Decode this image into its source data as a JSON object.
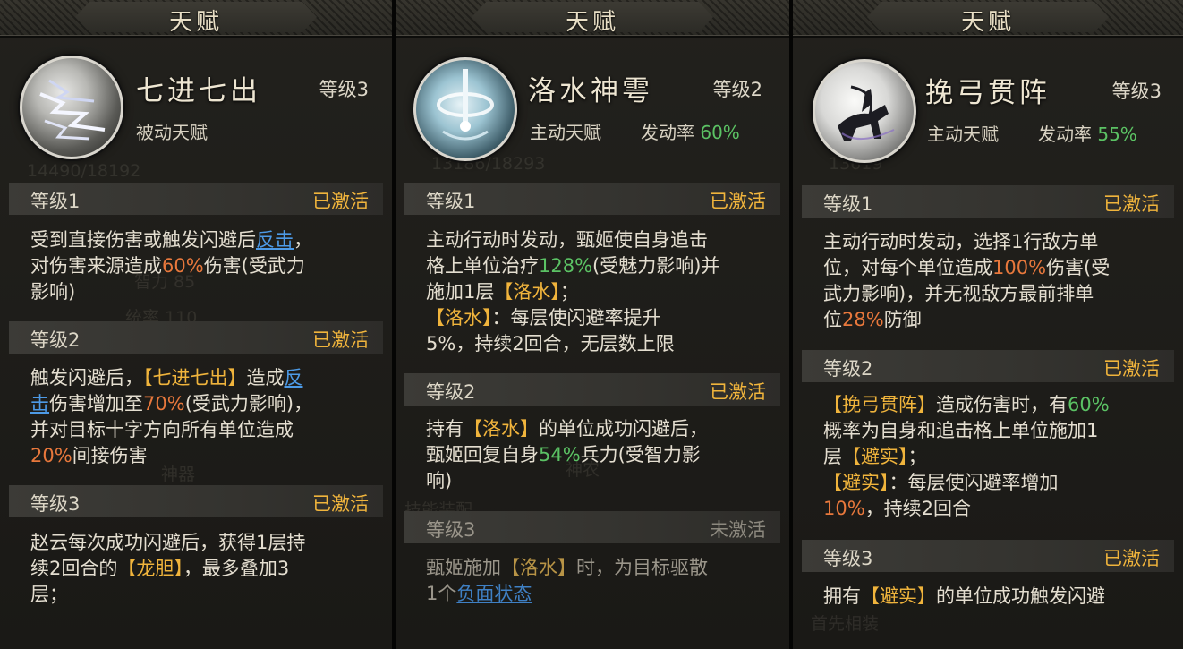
{
  "panels": [
    {
      "header": "天赋",
      "talent_name": "七进七出",
      "level": "等级3",
      "type": "被动天赋",
      "icon": "lightning-dragon-icon",
      "levels": [
        {
          "title": "等级1",
          "status": "已激活",
          "lines": [
            [
              "受到直接伤害或触发闪避后",
              "反击",
              "，"
            ],
            [
              "对伤害来源造成",
              "60%",
              "伤害(受武力"
            ],
            [
              "影响)"
            ]
          ]
        },
        {
          "title": "等级2",
          "status": "已激活",
          "lines": [
            [
              "触发闪避后，",
              "【七进七出】",
              "造成",
              "反"
            ],
            [
              "击",
              "伤害增加至",
              "70%",
              "(受武力影响)，"
            ],
            [
              "并对目标十字方向所有单位造成"
            ],
            [
              "20%",
              "间接伤害"
            ]
          ]
        },
        {
          "title": "等级3",
          "status": "已激活",
          "lines": [
            [
              "赵云每次成功闪避后，获得1层持"
            ],
            [
              "续2回合的",
              "【龙胆】",
              "，最多叠加3"
            ],
            [
              "层；"
            ]
          ]
        }
      ]
    },
    {
      "header": "天赋",
      "talent_name": "洛水神雩",
      "level": "等级2",
      "type": "主动天赋",
      "rate_label": "发动率",
      "rate_value": "60%",
      "icon": "water-vortex-icon",
      "levels": [
        {
          "title": "等级1",
          "status": "已激活",
          "lines": [
            [
              "主动行动时发动，甄姬使自身追击"
            ],
            [
              "格上单位治疗",
              "128%",
              "(受魅力影响)并"
            ],
            [
              "施加1层",
              "【洛水】",
              "；"
            ],
            [
              "【洛水】",
              "：每层使闪避率提升"
            ],
            [
              "5%，持续2回合，无层数上限"
            ]
          ]
        },
        {
          "title": "等级2",
          "status": "已激活",
          "lines": [
            [
              "持有",
              "【洛水】",
              "的单位成功闪避后，"
            ],
            [
              "甄姬回复自身",
              "54%",
              "兵力(受智力影"
            ],
            [
              "响)"
            ]
          ]
        },
        {
          "title": "等级3",
          "status": "未激活",
          "lines": [
            [
              "甄姬施加",
              "【洛水】",
              "时，为目标驱散"
            ],
            [
              "1个",
              "负面状态"
            ]
          ]
        }
      ]
    },
    {
      "header": "天赋",
      "talent_name": "挽弓贯阵",
      "level": "等级3",
      "type": "主动天赋",
      "rate_label": "发动率",
      "rate_value": "55%",
      "icon": "mounted-archer-icon",
      "levels": [
        {
          "title": "等级1",
          "status": "已激活",
          "lines": [
            [
              "主动行动时发动，选择1行敌方单"
            ],
            [
              "位，对每个单位造成",
              "100%",
              "伤害(受"
            ],
            [
              "武力影响)，并无视敌方最前排单"
            ],
            [
              "位",
              "28%",
              "防御"
            ]
          ]
        },
        {
          "title": "等级2",
          "status": "已激活",
          "lines": [
            [
              "【挽弓贯阵】",
              "造成伤害时，有",
              "60%"
            ],
            [
              "概率为自身和追击格上单位施加1"
            ],
            [
              "层",
              "【避实】",
              "；"
            ],
            [
              "【避实】",
              "：每层使闪避率增加"
            ],
            [
              "10%",
              "，持续2回合"
            ]
          ]
        },
        {
          "title": "等级3",
          "status": "已激活",
          "lines": [
            [
              "拥有",
              "【避实】",
              "的单位成功触发闪避"
            ]
          ]
        }
      ]
    }
  ],
  "colors": {
    "activated": "#f0b43c",
    "inactive": "#8c887e",
    "percent_orange": "#e8783c",
    "percent_green": "#5bc264",
    "keyword_yellow": "#f0b43c",
    "link_blue": "#4d9ae6"
  }
}
